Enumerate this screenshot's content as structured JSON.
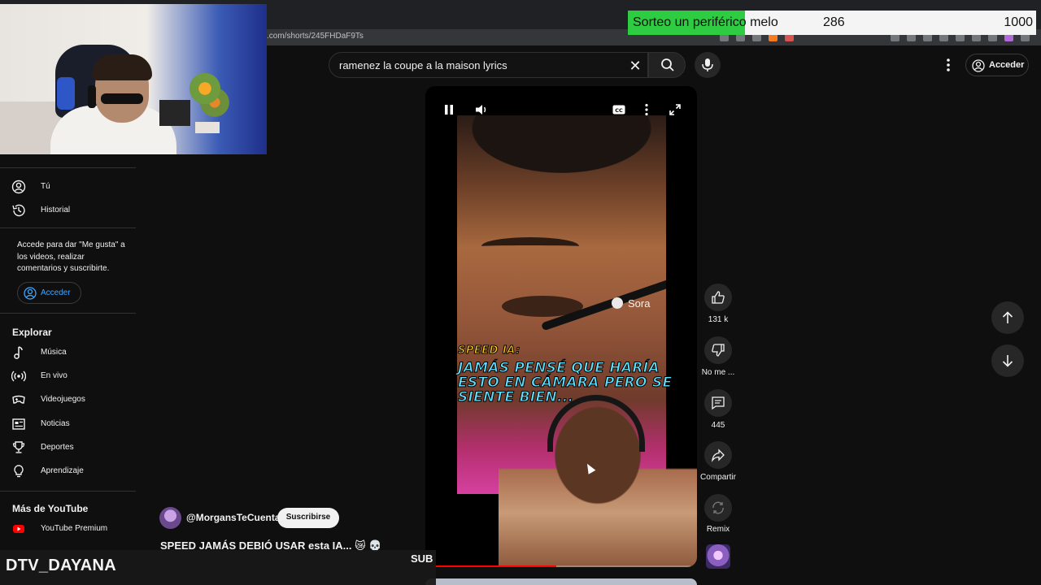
{
  "browser": {
    "url": ".com/shorts/245FHDaF9Ts"
  },
  "overlay": {
    "label": "Sorteo un periférico melo",
    "current": "286",
    "goal": "1000",
    "progress_fraction": 0.286
  },
  "header": {
    "search_query": "ramenez la coupe a la maison lyrics",
    "signin_label": "Acceder"
  },
  "sidebar": {
    "items_top": [
      {
        "label": "Tú",
        "icon": "user-icon"
      },
      {
        "label": "Historial",
        "icon": "history-icon"
      }
    ],
    "signin_note": "Accede para dar \"Me gusta\" a los videos, realizar comentarios y suscribirte.",
    "signin_label": "Acceder",
    "explore_title": "Explorar",
    "explore_items": [
      {
        "label": "Música",
        "icon": "music-icon"
      },
      {
        "label": "En vivo",
        "icon": "live-icon"
      },
      {
        "label": "Videojuegos",
        "icon": "gamepad-icon"
      },
      {
        "label": "Noticias",
        "icon": "news-icon"
      },
      {
        "label": "Deportes",
        "icon": "trophy-icon"
      },
      {
        "label": "Aprendizaje",
        "icon": "bulb-icon"
      }
    ],
    "more_title": "Más de YouTube",
    "more_items": [
      {
        "label": "YouTube Premium",
        "icon": "youtube-premium-icon"
      }
    ]
  },
  "video": {
    "watermark": "Sora",
    "caption_speaker": "SPEED IA:",
    "caption_lines": [
      "JAMÁS PENSÉ QUE HARÍA",
      "ESTO EN CÁMARA PERO SE",
      "SIENTE BIEN..."
    ],
    "progress_fraction": 0.48
  },
  "channel": {
    "handle": "@MorgansTeCuenta",
    "subscribe_label": "Suscribirse",
    "title": "SPEED JAMÁS DEBIÓ USAR esta IA... 😿 💀"
  },
  "actions": {
    "like_count": "131 k",
    "dislike_label": "No me ...",
    "comments_count": "445",
    "share_label": "Compartir",
    "remix_label": "Remix"
  },
  "stream": {
    "name": "DTV_DAYANA",
    "tag": "SUB"
  },
  "colors": {
    "background": "#0f0f0f",
    "overlay_fill": "#2ecc40",
    "progress": "#ff0000",
    "caption_yellow": "#ffd21f",
    "caption_cyan": "#5ee0ff",
    "link_blue": "#3ea6ff"
  }
}
